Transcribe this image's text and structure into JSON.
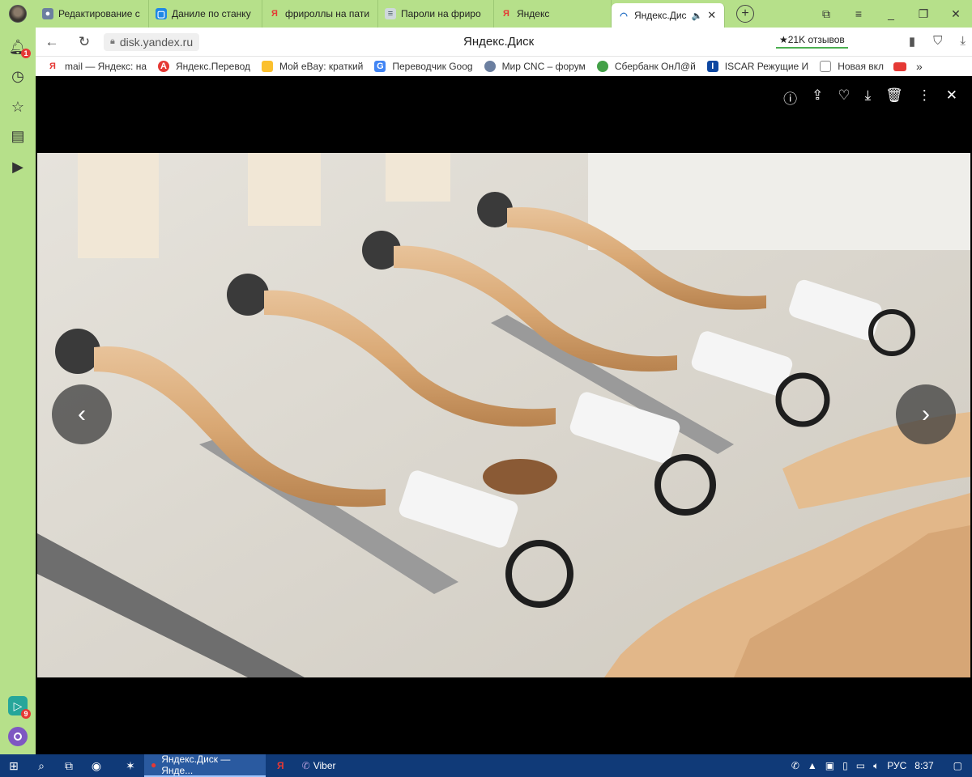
{
  "tabs": [
    {
      "label": "Редактирование с",
      "icon": "globe-icon",
      "color": "#6b7fa0"
    },
    {
      "label": "Данилe по станку",
      "icon": "box-icon",
      "color": "#1e88e5"
    },
    {
      "label": "фрироллы на пати",
      "icon": "yandex-icon",
      "color": "#e53935"
    },
    {
      "label": "Пароли на фриро",
      "icon": "doc-icon",
      "color": "#607d8b"
    },
    {
      "label": "Яндекс",
      "icon": "yandex-icon",
      "color": "#e53935"
    },
    {
      "label": "Яндекс.Дис",
      "icon": "disk-icon",
      "color": "#1565c0",
      "active": true
    }
  ],
  "address": {
    "url": "disk.yandex.ru",
    "title": "Яндекс.Диск",
    "reviews": "★21K отзывов"
  },
  "bookmarks": [
    {
      "label": "mail — Яндекс: на",
      "color": "#e53935"
    },
    {
      "label": "Яндекс.Перевод",
      "color": "#e53935"
    },
    {
      "label": "Мой eBay: краткий",
      "color": "#fbc02d"
    },
    {
      "label": "Переводчик Goog",
      "color": "#4285f4"
    },
    {
      "label": "Мир CNC – форум",
      "color": "#6b7fa0"
    },
    {
      "label": "Сбербанк ОнЛ@й",
      "color": "#43a047"
    },
    {
      "label": "ISCAR Режущие И",
      "color": "#0d47a1"
    },
    {
      "label": "Новая вкл",
      "color": "#888"
    }
  ],
  "sidebar": {
    "notif_count": "1",
    "viber_count": "9"
  },
  "taskbar": {
    "apps": [
      {
        "label": "Яндекс.Диск — Янде...",
        "active": true
      },
      {
        "label": "",
        "active": false
      },
      {
        "label": "Viber",
        "active": false
      }
    ],
    "lang": "РУС",
    "time": "8:37"
  }
}
